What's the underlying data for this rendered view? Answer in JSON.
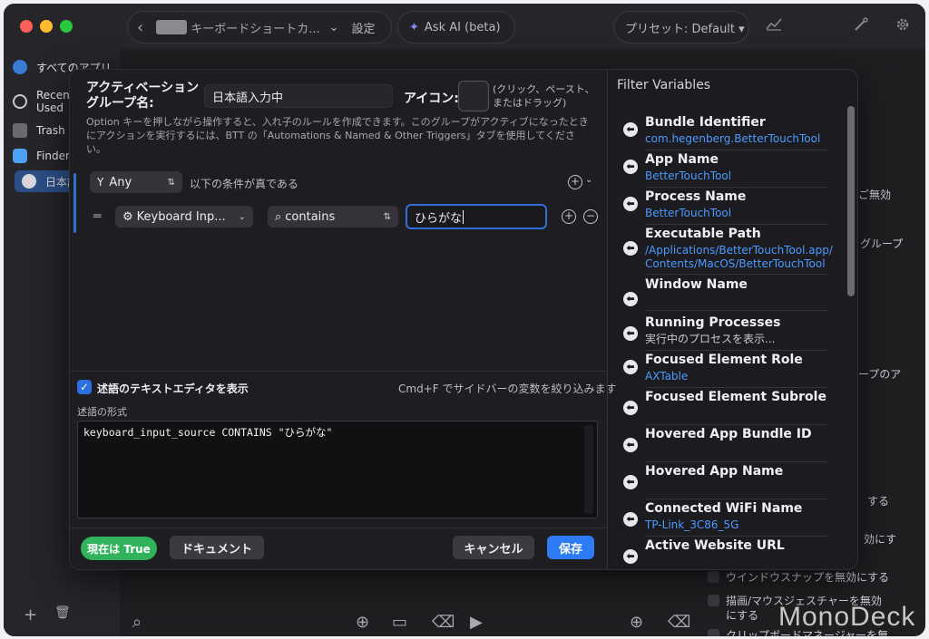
{
  "titlebar": {
    "back_glyph": "‹",
    "group_name": "キーボードショートカ...",
    "chevron": "⌄",
    "settings_label": "設定",
    "ask_ai_label": "Ask AI (beta)",
    "preset_label": "プリセット: Default ▾"
  },
  "sidebar": {
    "items": [
      {
        "label": "すべてのアプリ",
        "icon": "globe-icon"
      },
      {
        "label": "Recently Used",
        "icon": "recent-icon"
      },
      {
        "label": "Trash",
        "icon": "trash-icon"
      },
      {
        "label": "Finder",
        "icon": "finder-icon"
      },
      {
        "label": "日本語",
        "icon": "app-icon"
      }
    ],
    "add_glyph": "+",
    "delete_glyph": "🗑"
  },
  "background": {
    "items": [
      "ご無効",
      "グループ",
      "ープのア",
      "する",
      "効にす",
      "ウインドウスナップを無効にする",
      "描画/マウスジェスチャーを無効",
      "にする",
      "クリップボードマネージャーを無"
    ]
  },
  "dialog": {
    "name_label": "アクティベーション\nグループ名:",
    "name_value": "日本語入力中",
    "icon_label": "アイコン:",
    "icon_hint": "(クリック、ペースト、またはドラッグ)",
    "description": "Option キーを押しながら操作すると、入れ子のルールを作成できます。このグループがアクティブになったときにアクションを実行するには、BTT の「Automations & Named & Other Triggers」タブを使用してください。",
    "any_label": "Any",
    "any_suffix": "以下の条件が真である",
    "rule": {
      "drag_handle": "═",
      "variable": "Keyboard Inp...",
      "operator": "contains",
      "value": "ひらがな"
    },
    "show_editor_label": "述語のテキストエディタを表示",
    "shortcut_hint": "Cmd+F でサイドバーの変数を絞り込みます",
    "predicate_label": "述語の形式",
    "predicate_code": "keyboard_input_source CONTAINS \"ひらがな\"",
    "status_badge": "現在は True",
    "docs_button": "ドキュメント",
    "cancel_button": "キャンセル",
    "save_button": "保存"
  },
  "filter_panel": {
    "title": "Filter Variables",
    "items": [
      {
        "name": "Bundle Identifier",
        "value": "com.hegenberg.BetterTouchTool"
      },
      {
        "name": "App Name",
        "value": "BetterTouchTool"
      },
      {
        "name": "Process Name",
        "value": "BetterTouchTool"
      },
      {
        "name": "Executable Path",
        "value": "/Applications/BetterTouchTool.app/",
        "value2": "Contents/MacOS/BetterTouchTool"
      },
      {
        "name": "Window Name",
        "value": ""
      },
      {
        "name": "Running Processes",
        "value": "実行中のプロセスを表示..."
      },
      {
        "name": "Focused Element Role",
        "value": "AXTable"
      },
      {
        "name": "Focused Element Subrole",
        "value": ""
      },
      {
        "name": "Hovered App Bundle ID",
        "value": ""
      },
      {
        "name": "Hovered App Name",
        "value": ""
      },
      {
        "name": "Connected WiFi Name",
        "value": "TP-Link_3C86_5G"
      },
      {
        "name": "Active Website URL",
        "value": ""
      }
    ]
  },
  "watermark": "MonoDeck",
  "colors": {
    "accent": "#2d7cf6",
    "link": "#4c9aff",
    "status_green": "#31b35b",
    "window_bg": "#1f1f22"
  }
}
